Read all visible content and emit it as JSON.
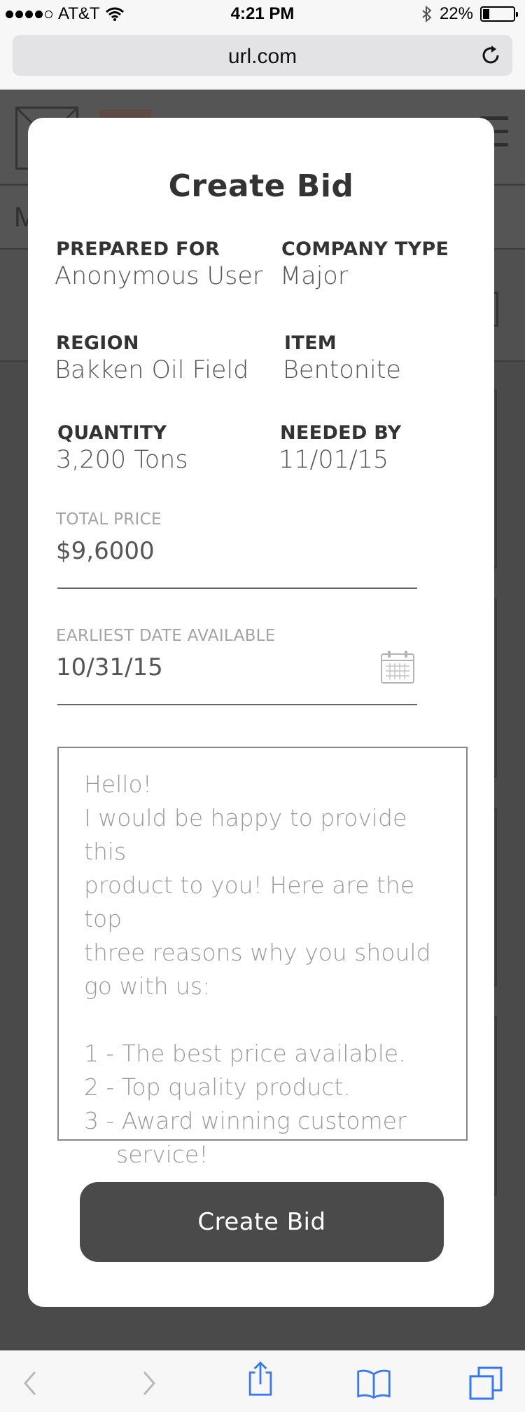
{
  "status_bar": {
    "carrier": "AT&T",
    "time": "4:21 PM",
    "battery": "22%",
    "battery_level": 0.22
  },
  "browser": {
    "url": "url.com"
  },
  "background_page": {
    "nav_initial": "M"
  },
  "modal": {
    "title": "Create Bid",
    "details": {
      "prepared_for_label": "PREPARED FOR",
      "prepared_for_value": "Anonymous User",
      "company_type_label": "COMPANY TYPE",
      "company_type_value": "Major",
      "region_label": "REGION",
      "region_value": "Bakken Oil Field",
      "item_label": "ITEM",
      "item_value": "Bentonite",
      "quantity_label": "QUANTITY",
      "quantity_value": "3,200 Tons",
      "needed_by_label": "NEEDED BY",
      "needed_by_value": "11/01/15"
    },
    "total_price": {
      "label": "TOTAL PRICE",
      "value": "$9,6000"
    },
    "earliest_date": {
      "label": "EARLIEST DATE AVAILABLE",
      "value": "10/31/15"
    },
    "message": {
      "line1": "Hello!",
      "line2": "I would be happy to provide this",
      "line3": "product to you! Here are the top",
      "line4": "three reasons why you should",
      "line5": "go with us:",
      "reason1": "1 - The best price available.",
      "reason2": "2 - Top quality product.",
      "reason3a": "3 - Award winning customer",
      "reason3b": "service!"
    },
    "submit_label": "Create Bid"
  },
  "icons": {
    "status": [
      "signal-dots-icon",
      "wifi-icon",
      "bluetooth-icon",
      "battery-icon"
    ],
    "browser": [
      "reload-icon"
    ],
    "modal": [
      "calendar-icon"
    ],
    "toolbar": [
      "back-arrow-icon",
      "forward-arrow-icon",
      "share-icon",
      "bookmarks-icon",
      "tabs-icon"
    ]
  },
  "colors": {
    "toolbar_icon": "#3478f6",
    "button_bg": "#4a4a4a",
    "overlay_bg": "#4a4a4a"
  }
}
